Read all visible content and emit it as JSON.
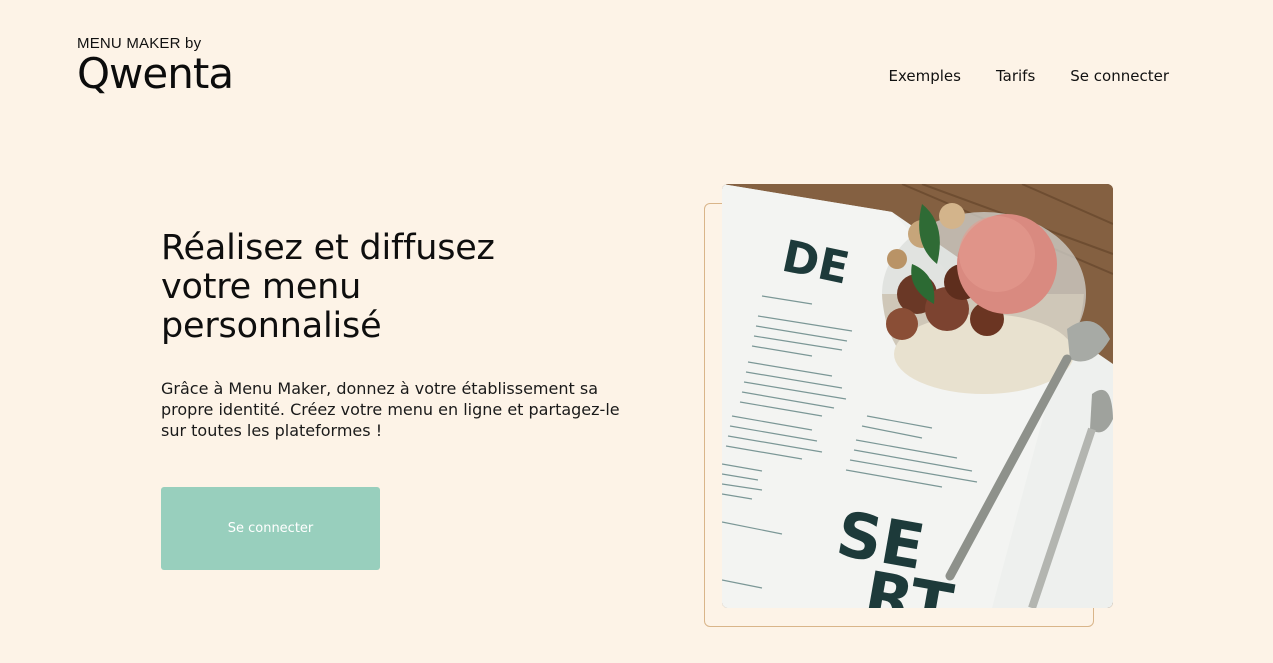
{
  "header": {
    "logo_top": "MENU MAKER by",
    "logo_word": "Qwenta",
    "nav": [
      {
        "label": "Exemples"
      },
      {
        "label": "Tarifs"
      },
      {
        "label": "Se connecter"
      }
    ]
  },
  "hero": {
    "title": "Réalisez et diffusez votre menu personnalisé",
    "description": "Grâce à Menu Maker, donnez à votre établissement sa propre identité. Créez votre menu en ligne et partagez-le sur toutes les plateformes !",
    "cta_label": "Se connecter"
  },
  "image": {
    "subject": "dessert-menu-photo",
    "menu_heading_top": "DE",
    "menu_heading_bottom_1": "SE",
    "menu_heading_bottom_2": "RT"
  },
  "colors": {
    "background": "#fdf3e7",
    "button": "#98cfbd",
    "frame_border": "#d9b58a",
    "text": "#111111"
  }
}
